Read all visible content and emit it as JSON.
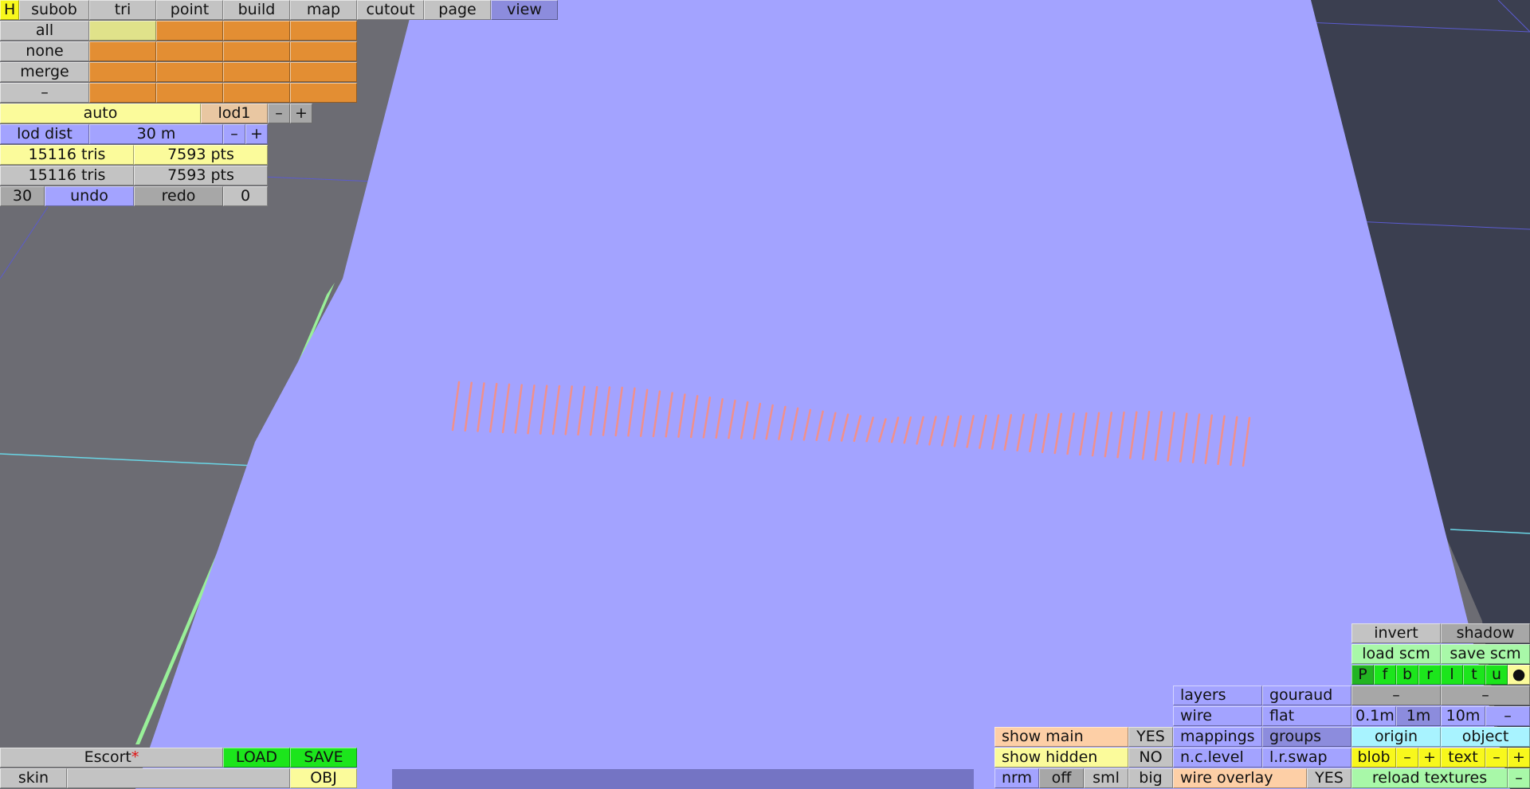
{
  "top_menu": {
    "items": [
      "H",
      "subob",
      "tri",
      "point",
      "build",
      "map",
      "cutout",
      "page",
      "view"
    ]
  },
  "selection_panel": {
    "all": "all",
    "none": "none",
    "merge": "merge",
    "minus": "–"
  },
  "lod": {
    "auto": "auto",
    "level": "lod1",
    "minus": "–",
    "plus": "+",
    "dist_label": "lod dist",
    "dist_value": "30 m"
  },
  "stats": {
    "row1_tris": "15116 tris",
    "row1_pts": "7593 pts",
    "row2_tris": "15116 tris",
    "row2_pts": "7593 pts"
  },
  "history": {
    "count": "30",
    "undo": "undo",
    "redo": "redo",
    "redo_count": "0"
  },
  "file": {
    "name": "Escort",
    "modified_mark": "*",
    "load": "LOAD",
    "save": "SAVE",
    "skin": "skin",
    "obj": "OBJ"
  },
  "display_options": {
    "show_main": "show main",
    "show_main_value": "YES",
    "show_hidden": "show hidden",
    "show_hidden_value": "NO",
    "nrm": "nrm",
    "off": "off",
    "sml": "sml",
    "big": "big",
    "layers": "layers",
    "gouraud": "gouraud",
    "wire": "wire",
    "flat": "flat",
    "mappings": "mappings",
    "groups": "groups",
    "nclevel": "n.c.level",
    "lrswap": "l.r.swap",
    "wire_overlay": "wire overlay",
    "wire_overlay_value": "YES"
  },
  "view_panel": {
    "invert": "invert",
    "shadow": "shadow",
    "load_scm": "load scm",
    "save_scm": "save scm",
    "views": [
      "P",
      "f",
      "b",
      "r",
      "l",
      "t",
      "u",
      "●"
    ],
    "minus1": "–",
    "minus2": "–",
    "grid_01": "0.1m",
    "grid_1": "1m",
    "grid_10": "10m",
    "grid_minus": "–",
    "origin": "origin",
    "object": "object",
    "blob": "blob",
    "blob_minus": "–",
    "blob_plus": "+",
    "text": "text",
    "text_minus": "–",
    "text_plus": "+",
    "reload_textures": "reload textures",
    "reload_minus": "–"
  },
  "colors": {
    "surface": "#a3a3ff",
    "normals": "#f0908c",
    "background": "#6c6c73"
  }
}
